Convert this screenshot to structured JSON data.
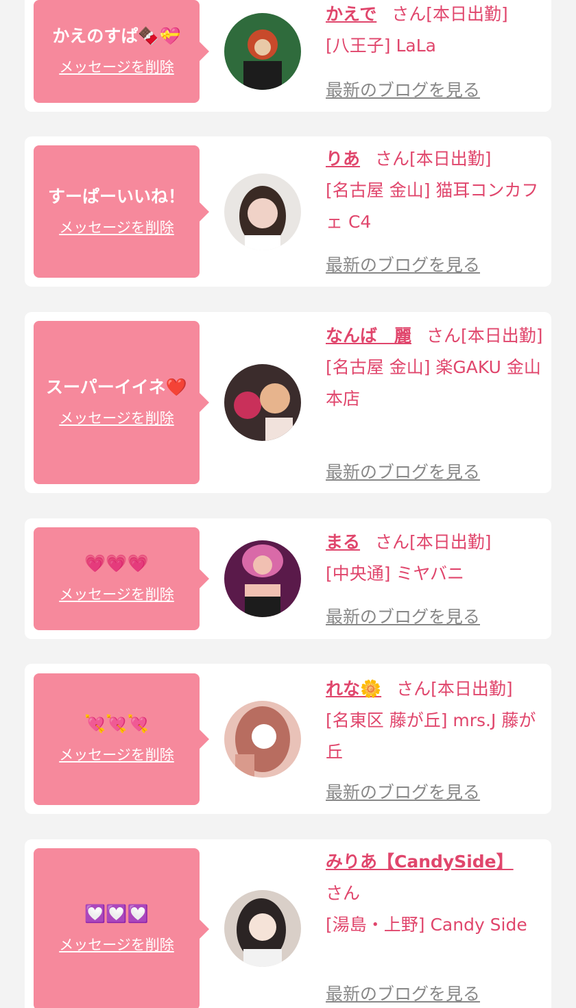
{
  "entries": [
    {
      "message": "かえのすぱ🍫💝",
      "delete_label": "メッセージを削除",
      "name": "かえで",
      "san": "さん",
      "status": "[本日出勤]",
      "shop": "[八王子] LaLa",
      "blog_label": "最新のブログを見る",
      "avatar_colors": [
        "#2f6b3c",
        "#c84a2b",
        "#e8c9a7"
      ]
    },
    {
      "message": "すーぱーいいね！",
      "delete_label": "メッセージを削除",
      "name": "りあ",
      "san": "さん",
      "status": "[本日出勤]",
      "shop": "[名古屋 金山] 猫耳コンカフェ C4",
      "blog_label": "最新のブログを見る",
      "avatar_colors": [
        "#e9e6e3",
        "#3a2a24",
        "#f0d2c7"
      ]
    },
    {
      "message": "スーパーイイネ❤️",
      "delete_label": "メッセージを削除",
      "name": "なんば　麗",
      "san": "さん",
      "status": "[本日出勤]",
      "shop": "[名古屋 金山] 楽GAKU 金山本店",
      "blog_label": "最新のブログを見る",
      "avatar_colors": [
        "#c9305a",
        "#e7b48d",
        "#3b2c2c"
      ]
    },
    {
      "message": "💗💗💗",
      "delete_label": "メッセージを削除",
      "name": "まる",
      "san": "さん",
      "status": "[本日出勤]",
      "shop": "[中央通] ミヤバニ",
      "blog_label": "最新のブログを見る",
      "avatar_colors": [
        "#5a1a4a",
        "#d96aa8",
        "#f1c0b2"
      ]
    },
    {
      "message": "💘💘💘",
      "delete_label": "メッセージを削除",
      "name": "れな🌼",
      "san": "さん",
      "status": "[本日出勤]",
      "shop": "[名東区 藤が丘] mrs.J 藤が丘",
      "blog_label": "最新のブログを見る",
      "avatar_colors": [
        "#e9c2b8",
        "#b86d60",
        "#ffffff"
      ]
    },
    {
      "message": "💟💟💟",
      "delete_label": "メッセージを削除",
      "name": "みりあ【CandySide】",
      "san": "さん",
      "status": "",
      "shop": "[湯島・上野] Candy Side",
      "blog_label": "最新のブログを見る",
      "avatar_colors": [
        "#2b2424",
        "#d9cfc8",
        "#f5e3d8"
      ]
    }
  ]
}
